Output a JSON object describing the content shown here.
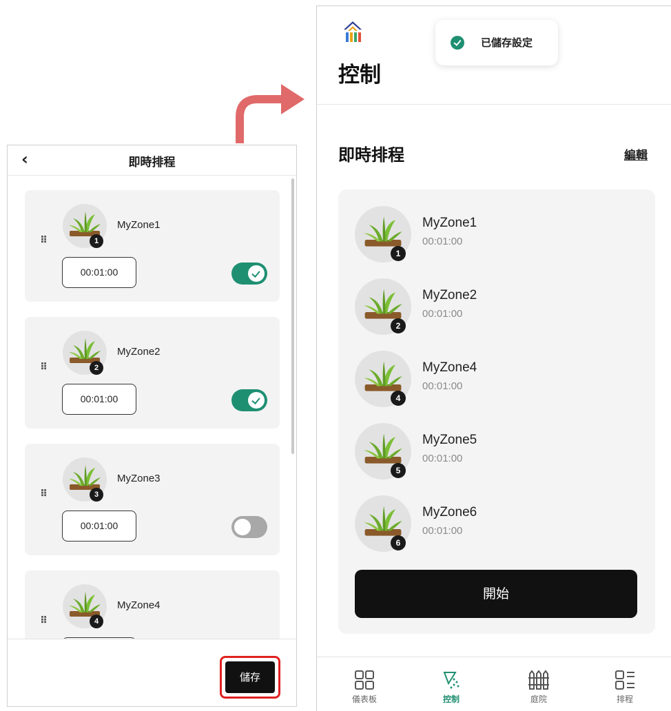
{
  "left_panel": {
    "back_icon": "chevron-left-icon",
    "title": "即時排程",
    "zones": [
      {
        "name": "MyZone1",
        "badge": "1",
        "duration": "00:01:00",
        "enabled": true
      },
      {
        "name": "MyZone2",
        "badge": "2",
        "duration": "00:01:00",
        "enabled": true
      },
      {
        "name": "MyZone3",
        "badge": "3",
        "duration": "00:01:00",
        "enabled": false
      },
      {
        "name": "MyZone4",
        "badge": "4",
        "duration": "",
        "enabled": null
      }
    ],
    "save_label": "儲存",
    "save_highlight_color": "#e02020"
  },
  "right_panel": {
    "toast": {
      "text": "已儲存設定",
      "icon": "check-circle-icon"
    },
    "page_title": "控制",
    "section_title": "即時排程",
    "edit_label": "編輯",
    "zones": [
      {
        "name": "MyZone1",
        "badge": "1",
        "duration": "00:01:00"
      },
      {
        "name": "MyZone2",
        "badge": "2",
        "duration": "00:01:00"
      },
      {
        "name": "MyZone4",
        "badge": "4",
        "duration": "00:01:00"
      },
      {
        "name": "MyZone5",
        "badge": "5",
        "duration": "00:01:00"
      },
      {
        "name": "MyZone6",
        "badge": "6",
        "duration": "00:01:00"
      }
    ],
    "start_label": "開始",
    "nav": [
      {
        "label": "儀表板",
        "icon": "grid-icon",
        "active": false
      },
      {
        "label": "控制",
        "icon": "sprinkler-icon",
        "active": true
      },
      {
        "label": "庭院",
        "icon": "fence-icon",
        "active": false
      },
      {
        "label": "排程",
        "icon": "schedule-list-icon",
        "active": false
      }
    ]
  },
  "colors": {
    "accent": "#1f8f72",
    "primary_button": "#111111",
    "arrow": "#e06a6a"
  }
}
